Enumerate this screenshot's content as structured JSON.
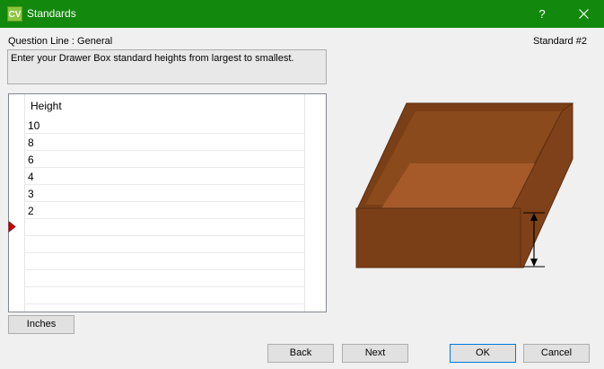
{
  "window": {
    "app_icon_text": "CV",
    "title": "Standards",
    "help_label": "?",
    "close_icon": "close-icon"
  },
  "header": {
    "question_line": "Question Line : General",
    "standard_number": "Standard #2"
  },
  "instruction": "Enter your Drawer Box standard heights from largest to smallest.",
  "grid": {
    "column_header": "Height",
    "rows": [
      "10",
      "8",
      "6",
      "4",
      "3",
      "2"
    ],
    "new_row_marker_icon": "current-row-arrow-icon"
  },
  "units_button": "Inches",
  "buttons": {
    "back": "Back",
    "next": "Next",
    "ok": "OK",
    "cancel": "Cancel"
  },
  "illustration": {
    "name": "drawer-box-height-diagram",
    "colors": {
      "box_dark": "#7a3f17",
      "box_mid": "#8a4a1c",
      "box_floor": "#a65a2a",
      "dimension_line": "#000000"
    }
  },
  "colors": {
    "titlebar": "#12880c",
    "app_icon": "#8cc63f",
    "focus_border": "#0078d7",
    "row_marker": "#d40000"
  }
}
